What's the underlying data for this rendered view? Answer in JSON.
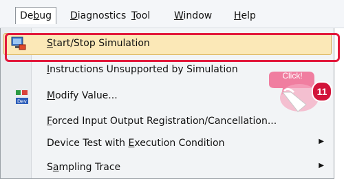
{
  "menubar": {
    "debug_pre": "De",
    "debug_u": "b",
    "debug_post": "ug",
    "diagnostics_u": "D",
    "diagnostics_post": "iagnostics",
    "tool_u": "T",
    "tool_post": "ool",
    "window_u": "W",
    "window_post": "indow",
    "help_u": "H",
    "help_post": "elp"
  },
  "menu": {
    "start_stop_u": "S",
    "start_stop_post": "tart/Stop Simulation",
    "unsupported_u": "I",
    "unsupported_post": "nstructions Unsupported by Simulation",
    "modify_u": "M",
    "modify_post": "odify Value...",
    "forced_u": "F",
    "forced_post": "orced Input Output Registration/Cancellation...",
    "device_test_pre": "Device Test with ",
    "device_test_u": "E",
    "device_test_post": "xecution Condition",
    "sampling_pre": "S",
    "sampling_u": "a",
    "sampling_post": "mpling Trace"
  },
  "callout": {
    "text": "Click!",
    "step": "11"
  },
  "colors": {
    "highlight_frame": "#e2183b",
    "hover_fill": "#fbe8b7",
    "callout_pink": "#f07ea0",
    "badge": "#d2143a"
  }
}
